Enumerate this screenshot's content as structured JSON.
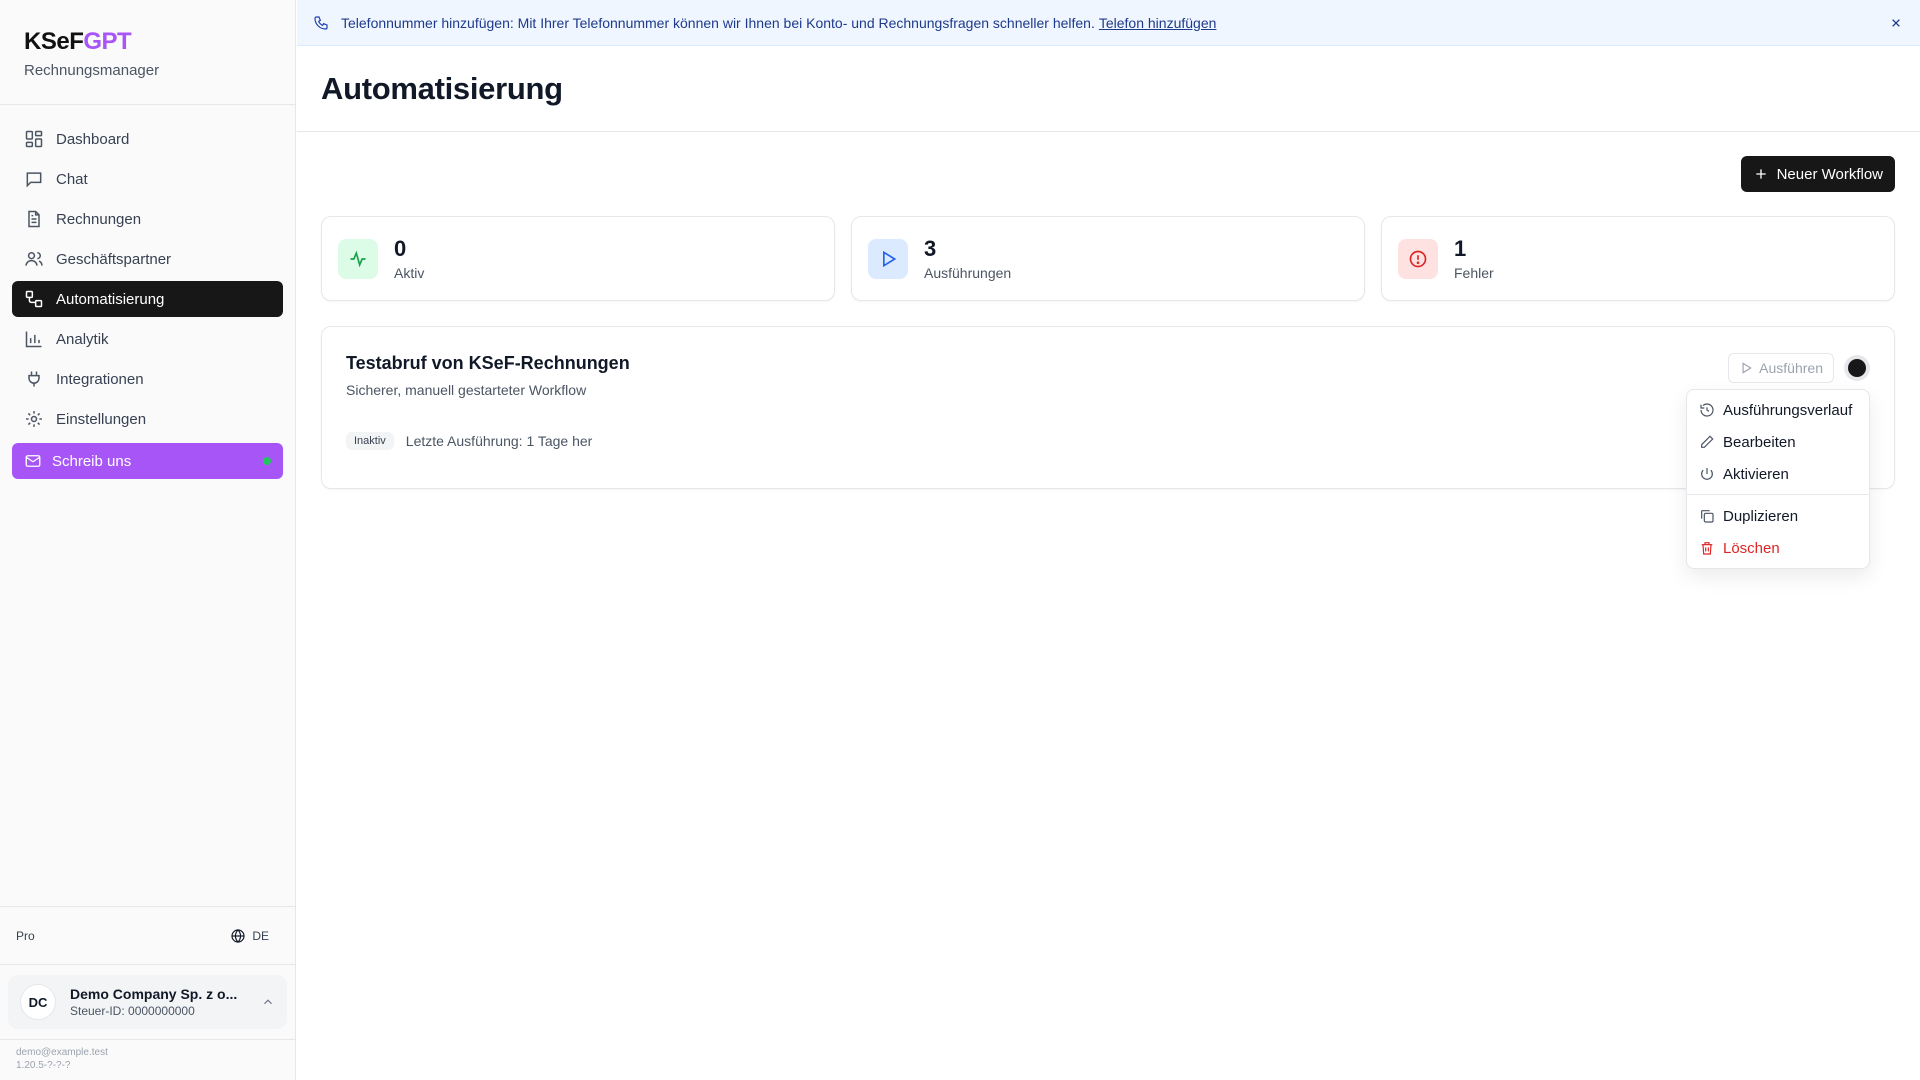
{
  "brand": {
    "logo_part1": "KSeF",
    "logo_part2": "GPT",
    "subtitle": "Rechnungsmanager",
    "accent_color": "#a855f7"
  },
  "sidebar": {
    "items": [
      {
        "label": "Dashboard",
        "icon": "dashboard-icon"
      },
      {
        "label": "Chat",
        "icon": "chat-icon"
      },
      {
        "label": "Rechnungen",
        "icon": "document-icon"
      },
      {
        "label": "Geschäftspartner",
        "icon": "users-icon"
      },
      {
        "label": "Automatisierung",
        "icon": "workflow-icon",
        "active": true
      },
      {
        "label": "Analytik",
        "icon": "bar-chart-icon"
      },
      {
        "label": "Integrationen",
        "icon": "plug-icon"
      },
      {
        "label": "Einstellungen",
        "icon": "gear-icon"
      }
    ],
    "contact_label": "Schreib uns",
    "plan": "Pro",
    "language": "DE",
    "account": {
      "initials": "DC",
      "name": "Demo Company Sp. z o...",
      "tax_id": "Steuer-ID: 0000000000"
    },
    "email": "demo@example.test",
    "version": "1.20.5-?-?-?"
  },
  "banner": {
    "text": "Telefonnummer hinzufügen: Mit Ihrer Telefonnummer können wir Ihnen bei Konto- und Rechnungsfragen schneller helfen.",
    "link": "Telefon hinzufügen"
  },
  "header": {
    "title": "Automatisierung"
  },
  "toolbar": {
    "new_workflow_label": "Neuer Workflow"
  },
  "stats": [
    {
      "value": "0",
      "label": "Aktiv",
      "color": "#16a34a"
    },
    {
      "value": "3",
      "label": "Ausführungen",
      "color": "#2563eb"
    },
    {
      "value": "1",
      "label": "Fehler",
      "color": "#dc2626"
    }
  ],
  "workflow": {
    "title": "Testabruf von KSeF-Rechnungen",
    "description": "Sicherer, manuell gestarteter Workflow",
    "status": "Inaktiv",
    "last_run": "Letzte Ausführung: 1 Tage her",
    "run_label": "Ausführen"
  },
  "menu": {
    "items": [
      {
        "label": "Ausführungsverlauf",
        "icon": "history-icon"
      },
      {
        "label": "Bearbeiten",
        "icon": "pencil-icon"
      },
      {
        "label": "Aktivieren",
        "icon": "power-icon"
      },
      {
        "label": "Duplizieren",
        "icon": "copy-icon"
      },
      {
        "label": "Löschen",
        "icon": "trash-icon",
        "danger": true
      }
    ]
  }
}
